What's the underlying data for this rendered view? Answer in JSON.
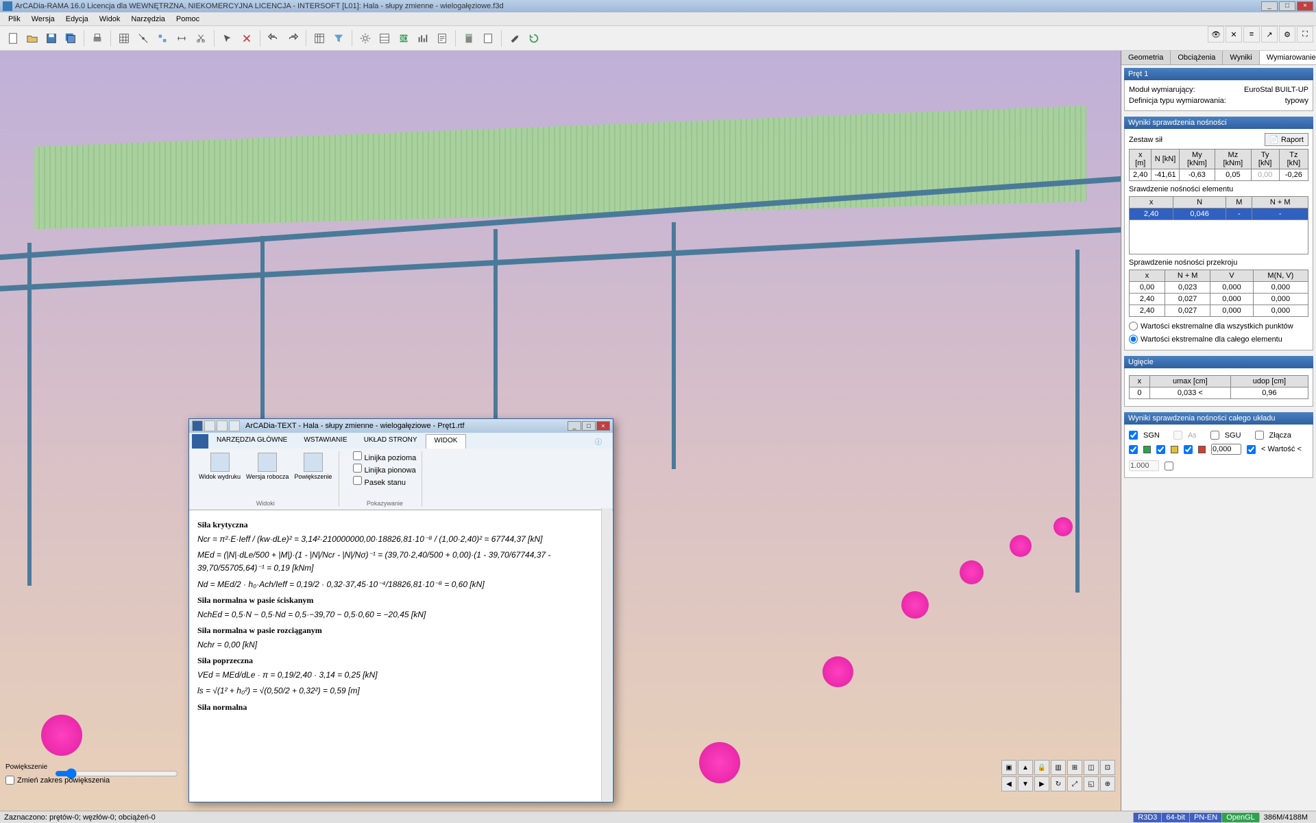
{
  "titlebar": {
    "title": "ArCADia-RAMA 16.0 Licencja dla WEWNĘTRZNA, NIEKOMERCYJNA LICENCJA - INTERSOFT [L01]: Hala - słupy zmienne - wielogałęziowe.f3d"
  },
  "menubar": {
    "items": [
      "Plik",
      "Wersja",
      "Edycja",
      "Widok",
      "Narzędzia",
      "Pomoc"
    ]
  },
  "rightpanel": {
    "tabs": [
      "Geometria",
      "Obciążenia",
      "Wyniki",
      "Wymiarowanie"
    ],
    "active_tab": "Wymiarowanie",
    "pret_header": "Pręt 1",
    "modul_label": "Moduł wymiarujący:",
    "modul_value": "EuroStal BUILT-UP",
    "def_label": "Definicja typu wymiarowania:",
    "def_value": "typowy",
    "wyniki_header": "Wyniki sprawdzenia nośności",
    "zestaw_label": "Zestaw sił",
    "raport_btn": "Raport",
    "forces_headers": [
      "x\n[m]",
      "N\n[kN]",
      "My\n[kNm]",
      "Mz\n[kNm]",
      "Ty\n[kN]",
      "Tz\n[kN]"
    ],
    "forces_row": [
      "2,40",
      "-41,61",
      "-0,63",
      "0,05",
      "0,00",
      "-0,26"
    ],
    "sprawdz_el_label": "Srawdzenie nośności elementu",
    "el_headers": [
      "x",
      "N",
      "M",
      "N + M"
    ],
    "el_row": [
      "2,40",
      "0,046",
      "-",
      "-"
    ],
    "sprawdz_prz_label": "Sprawdzenie nośności przekroju",
    "prz_headers": [
      "x",
      "N + M",
      "V",
      "M(N, V)"
    ],
    "prz_rows": [
      [
        "0,00",
        "0,023",
        "0,000",
        "0,000"
      ],
      [
        "2,40",
        "0,027",
        "0,000",
        "0,000"
      ],
      [
        "2,40",
        "0,027",
        "0,000",
        "0,000"
      ]
    ],
    "radio1": "Wartości ekstremalne dla wszystkich punktów",
    "radio2": "Wartości ekstremalne dla całego elementu",
    "ugiecie_header": "Ugięcie",
    "ugiecie_headers": [
      "x",
      "umax [cm]",
      "udop [cm]"
    ],
    "ugiecie_row": [
      "0",
      "0,033 <",
      "0,96"
    ],
    "uklad_header": "Wyniki sprawdzenia nośności całego układu",
    "sgn": "SGN",
    "as": "As",
    "sgu": "SGU",
    "zlacza": "Złącza",
    "wartosc_lt": "< Wartość <",
    "val1": "0,000",
    "val2": "1.000"
  },
  "viewport": {
    "zoom_label": "Powiększenie",
    "zoom_check": "Zmień zakres powiększenia"
  },
  "floatwin": {
    "title": "ArCADia-TEXT - Hala - słupy zmienne - wielogałęziowe - Pręt1.rtf",
    "tabs": [
      "NARZĘDZIA GŁÓWNE",
      "WSTAWIANIE",
      "UKŁAD STRONY",
      "WIDOK"
    ],
    "active_tab": "WIDOK",
    "group1": {
      "btn1": "Widok wydruku",
      "btn2": "Wersja robocza",
      "btn3": "Powiększenie",
      "name": "Widoki"
    },
    "group2": {
      "chk1": "Linijka pozioma",
      "chk2": "Linijka pionowa",
      "chk3": "Pasek stanu",
      "name": "Pokazywanie"
    },
    "doc": {
      "h1": "Siła krytyczna",
      "eq1": "Ncr = π²·E·Ieff / (kw·dLe)² = 3,14²·210000000,00·18826,81·10⁻⁸ / (1,00·2,40)² = 67744,37 [kN]",
      "eq2": "MEd = (|N|·dLe/500 + |M|)·(1 - |N|/Ncr - |N|/Nσ)⁻¹ = (39,70·2,40/500 + 0,00)·(1 - 39,70/67744,37 - 39,70/55705,64)⁻¹ = 0,19 [kNm]",
      "eq3": "Nd = MEd/2 · h₀·Ach/Ieff = 0,19/2 · 0,32·37,45·10⁻⁴/18826,81·10⁻⁸ = 0,60 [kN]",
      "h2": "Siła normalna w pasie ściskanym",
      "eq4": "NchEd = 0,5·N − 0,5·Nd = 0,5·−39,70 − 0,5·0,60 = −20,45 [kN]",
      "h3": "Siła normalna w pasie rozciąganym",
      "eq5": "Nchr = 0,00 [kN]",
      "h4": "Siła poprzeczna",
      "eq6": "VEd = MEd/dLe · π = 0,19/2,40 · 3,14 = 0,25 [kN]",
      "eq7": "ls = √(1² + h₀²) = √(0,50/2 + 0,32²) = 0,59 [m]",
      "h5": "Siła normalna"
    }
  },
  "statusbar": {
    "sel": "Zaznaczono: prętów-0; węzłów-0; obciążeń-0",
    "r3d3": "R3D3",
    "bit": "64-bit",
    "pnen": "PN-EN",
    "opengl": "OpenGL",
    "mem": "386M/4188M"
  }
}
